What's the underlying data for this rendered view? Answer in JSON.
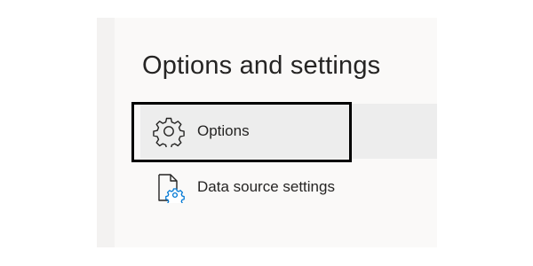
{
  "panel": {
    "title": "Options and settings",
    "items": [
      {
        "label": "Options",
        "icon": "gear-icon",
        "selected": true
      },
      {
        "label": "Data source settings",
        "icon": "data-source-settings-icon",
        "selected": false
      }
    ]
  },
  "colors": {
    "panel_background": "#faf9f8",
    "panel_strip": "#f3f2f1",
    "selected_background": "#ededed",
    "text": "#252423",
    "icon_accent": "#0078d4",
    "highlight_border": "#000000"
  }
}
